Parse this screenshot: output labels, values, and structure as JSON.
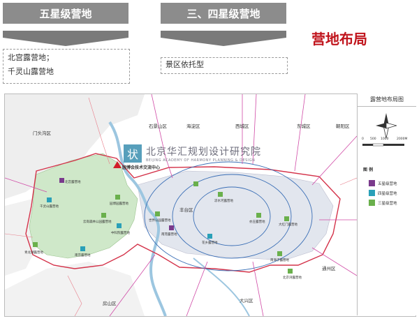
{
  "header": {
    "five_star": "五星级营地",
    "three_four_star": "三、四星级营地",
    "page_title": "营地布局"
  },
  "five_star_list": [
    "北宫露营地；",
    "千灵山露营地"
  ],
  "three_four_list": [
    "景区依托型"
  ],
  "map": {
    "panel_title": "露营地布局图",
    "scale_labels": [
      "0",
      "500",
      "1000",
      "2000M"
    ],
    "legend_title": "图 例",
    "legend": [
      {
        "label": "五星级营地",
        "color": "#7a3a8c"
      },
      {
        "label": "四星级营地",
        "color": "#2aa0b8"
      },
      {
        "label": "三星级营地",
        "color": "#6ab04c"
      }
    ],
    "districts": [
      "门头沟区",
      "石景山区",
      "海淀区",
      "西城区",
      "东城区",
      "朝阳区",
      "丰台区",
      "房山区",
      "大兴区",
      "通州区"
    ],
    "center_label": "园博会技术交流中心",
    "watermark_cn": "北京华汇规划设计研究院",
    "watermark_en": "BEIJING ACADEMY OF HARMONY PLANNING & DESIGN",
    "sites": [
      "北宫露营地",
      "千灵山露营地",
      "园博园露营地",
      "云岗森林公园露营地",
      "中科院露营地",
      "青龙湖露营地",
      "南宫露营地",
      "南苑露营地",
      "凉水河露营地",
      "花乡露营地",
      "世界公园露营地",
      "南海子露营地",
      "大红门露营地",
      "亦庄露营地",
      "北京湾露营地"
    ]
  }
}
